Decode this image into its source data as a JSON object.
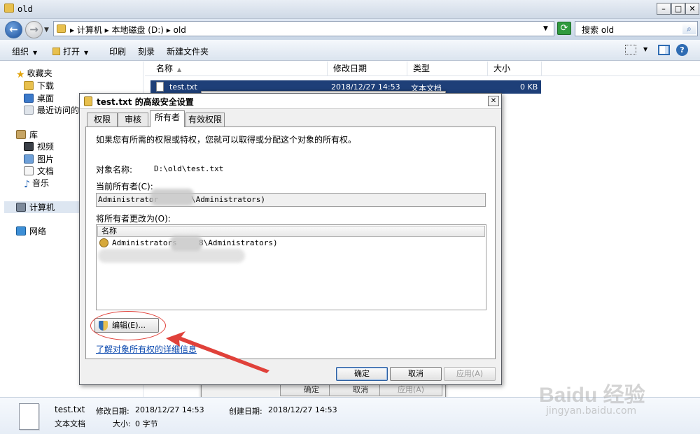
{
  "window": {
    "title": "old"
  },
  "address": {
    "crumbs": "▸ 计算机 ▸ 本地磁盘 (D:) ▸ old",
    "search_placeholder": "搜索 old"
  },
  "toolbar": {
    "organize": "组织",
    "open": "打开",
    "print": "印刷",
    "burn": "刻录",
    "new_folder": "新建文件夹"
  },
  "nav": {
    "favorites": "收藏夹",
    "downloads": "下载",
    "desktop": "桌面",
    "recent": "最近访问的",
    "libraries": "库",
    "videos": "视频",
    "pictures": "图片",
    "documents": "文档",
    "music": "音乐",
    "computer": "计算机",
    "network": "网络"
  },
  "file_list": {
    "columns": [
      "名称",
      "修改日期",
      "类型",
      "大小"
    ],
    "rows": [
      {
        "name": "test.txt",
        "modified": "2018/12/27 14:53",
        "type": "文本文档",
        "size": "0 KB"
      }
    ]
  },
  "bg_dialog": {
    "ok": "确定",
    "cancel": "取消",
    "apply": "应用(A)"
  },
  "details": {
    "filename": "test.txt",
    "modified_label": "修改日期:",
    "modified": "2018/12/27 14:53",
    "created_label": "创建日期:",
    "created": "2018/12/27 14:53",
    "type": "文本文档",
    "size_label": "大小:",
    "size": "0 字节"
  },
  "dialog": {
    "title": "test.txt 的高级安全设置",
    "tabs": [
      "权限",
      "审核",
      "所有者",
      "有效权限"
    ],
    "active_tab": "所有者",
    "intro": "如果您有所需的权限或特权，您就可以取得或分配这个对象的所有权。",
    "object_name_label": "对象名称:",
    "object_name": "D:\\old\\test.txt",
    "current_owner_label": "当前所有者(C):",
    "current_owner_left": "Administrator",
    "current_owner_right": "\\Administrators)",
    "change_owner_label": "将所有者更改为(O):",
    "list_header": "名称",
    "list_row_left": "Administrators",
    "list_row_right": "8\\Administrators)",
    "edit_button": "编辑(E)...",
    "learn_link": "了解对象所有权的详细信息",
    "ok": "确定",
    "cancel": "取消",
    "apply": "应用(A)"
  },
  "watermark": {
    "logo": "Baidu 经验",
    "url": "jingyan.baidu.com"
  },
  "colors": {
    "selection": "#1e3f78",
    "annotation": "#e0413a",
    "link": "#0645ad"
  }
}
